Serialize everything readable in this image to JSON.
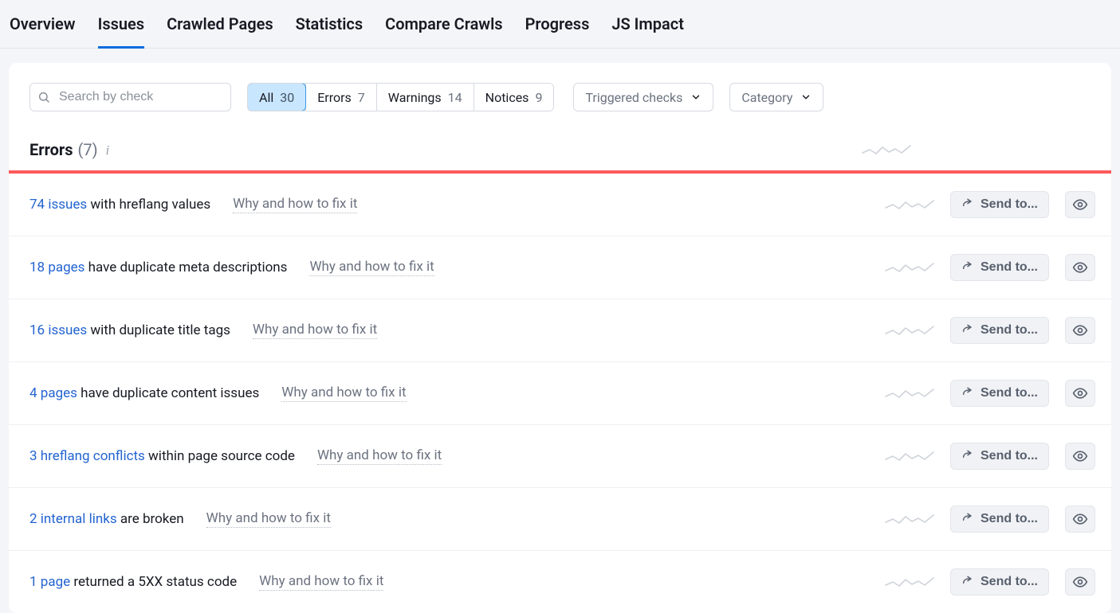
{
  "nav": {
    "items": [
      {
        "label": "Overview"
      },
      {
        "label": "Issues"
      },
      {
        "label": "Crawled Pages"
      },
      {
        "label": "Statistics"
      },
      {
        "label": "Compare Crawls"
      },
      {
        "label": "Progress"
      },
      {
        "label": "JS Impact"
      }
    ],
    "active_index": 1
  },
  "search": {
    "placeholder": "Search by check"
  },
  "filter_tabs": [
    {
      "label": "All",
      "count": "30"
    },
    {
      "label": "Errors",
      "count": "7"
    },
    {
      "label": "Warnings",
      "count": "14"
    },
    {
      "label": "Notices",
      "count": "9"
    }
  ],
  "filter_active_index": 0,
  "dropdowns": {
    "triggered": "Triggered checks",
    "category": "Category"
  },
  "section": {
    "title": "Errors",
    "count_display": "(7)"
  },
  "fix_label": "Why and how to fix it",
  "send_label": "Send to...",
  "issues": [
    {
      "link": "74 issues",
      "suffix": " with hreflang values"
    },
    {
      "link": "18 pages",
      "suffix": " have duplicate meta descriptions"
    },
    {
      "link": "16 issues",
      "suffix": " with duplicate title tags"
    },
    {
      "link": "4 pages",
      "suffix": " have duplicate content issues"
    },
    {
      "link": "3 hreflang conflicts",
      "suffix": " within page source code"
    },
    {
      "link": "2 internal links",
      "suffix": " are broken"
    },
    {
      "link": "1 page",
      "suffix": " returned a 5XX status code"
    }
  ],
  "colors": {
    "accent_blue": "#0a6bdc",
    "link_blue": "#2364d0",
    "error_red": "#ff5a5a"
  }
}
